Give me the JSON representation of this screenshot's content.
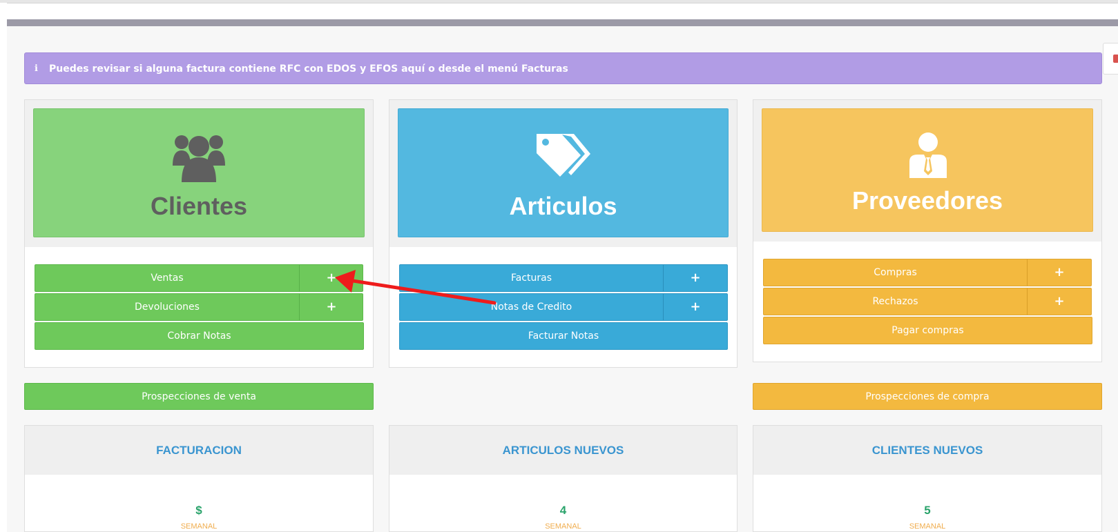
{
  "alert": {
    "icon": "info-icon",
    "text": "Puedes revisar si alguna factura contiene RFC con EDOS y EFOS aquí o desde el menú Facturas"
  },
  "colors": {
    "green": "#6ec95b",
    "green_hero": "#87d37c",
    "blue": "#39aad8",
    "blue_hero": "#53b8e0",
    "orange": "#f3b93f",
    "orange_hero": "#f6c55e",
    "alert": "#b19ce5",
    "stat_title": "#3a95d0",
    "stat_value": "#2aa36b",
    "stat_period": "#f0ad4e",
    "arrow": "#ee1c1c"
  },
  "clientes": {
    "icon": "users-icon",
    "title": "Clientes",
    "ventas": "Ventas",
    "devoluciones": "Devoluciones",
    "cobrar": "Cobrar Notas",
    "plus": "+"
  },
  "articulos": {
    "icon": "tags-icon",
    "title": "Articulos",
    "facturas": "Facturas",
    "notas_credito": "Notas de Credito",
    "facturar": "Facturar Notas",
    "plus": "+"
  },
  "proveedores": {
    "icon": "businessman-icon",
    "title": "Proveedores",
    "compras": "Compras",
    "rechazos": "Rechazos",
    "pagar": "Pagar compras",
    "plus": "+"
  },
  "prospecciones": {
    "venta": "Prospecciones de venta",
    "compra": "Prospecciones de compra"
  },
  "stats": [
    {
      "title": "FACTURACION",
      "value": "$",
      "period": "SEMANAL"
    },
    {
      "title": "ARTICULOS NUEVOS",
      "value": "4",
      "period": "SEMANAL"
    },
    {
      "title": "CLIENTES NUEVOS",
      "value": "5",
      "period": "SEMANAL"
    }
  ]
}
